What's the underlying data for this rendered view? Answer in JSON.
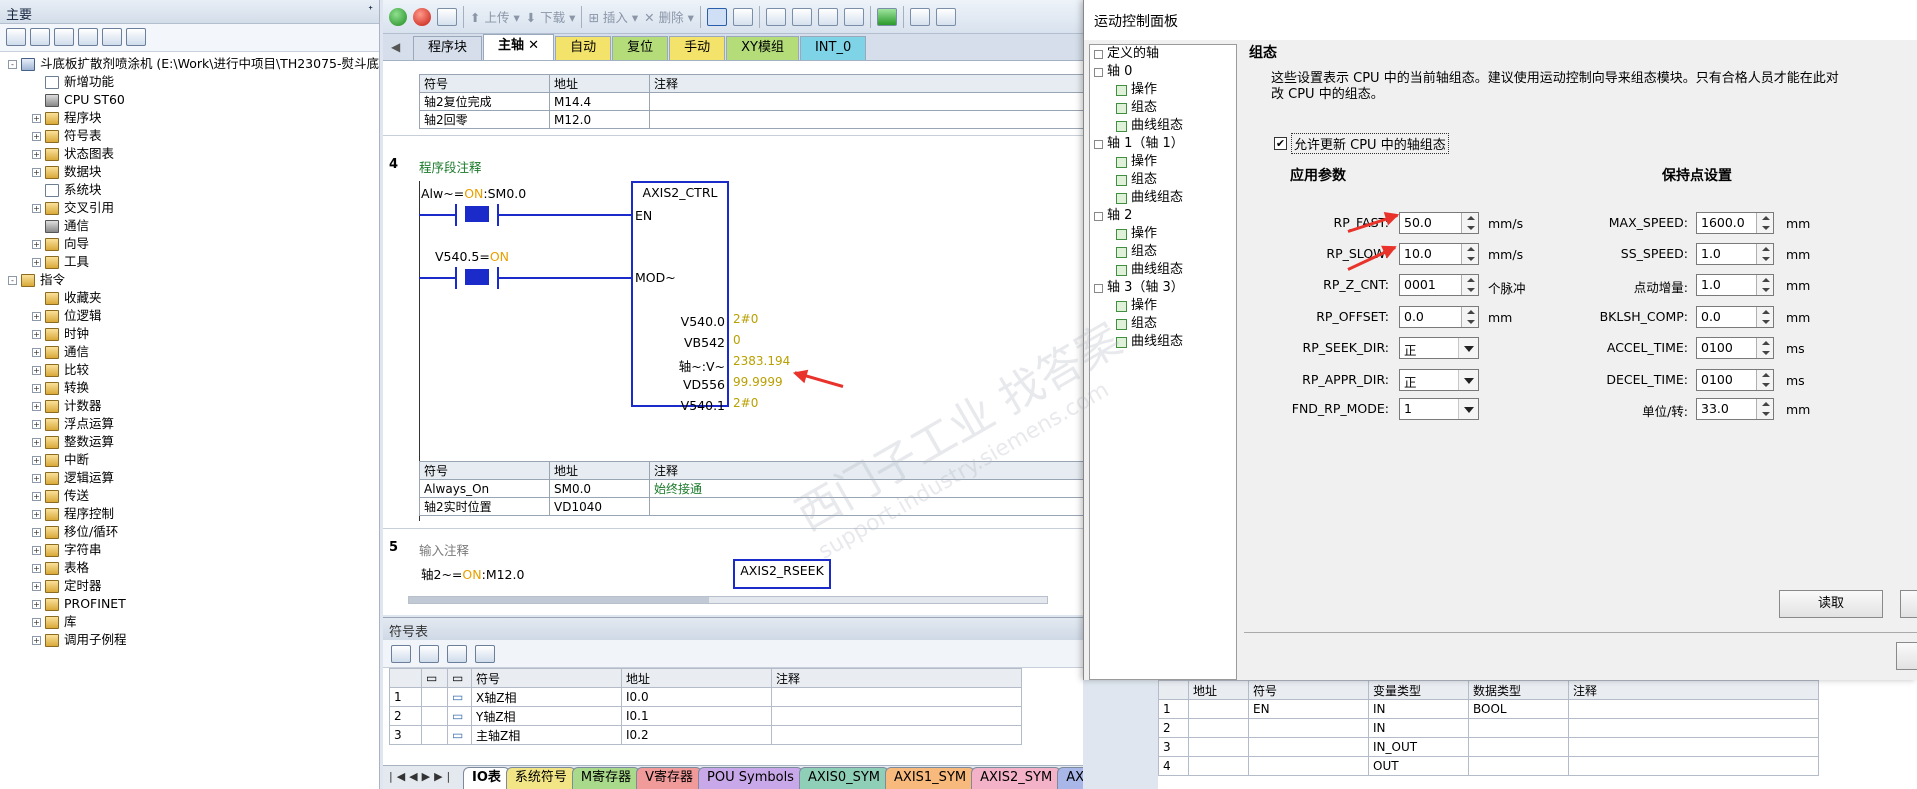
{
  "left_panel": {
    "title": "主要",
    "pin": "ᐩ",
    "tree": [
      {
        "label": "斗底板扩散剂喷涂机 (E:\\Work\\进行中项目\\TH23075-熨斗底",
        "level": 0,
        "exp": "-"
      },
      {
        "label": "新增功能",
        "level": 1,
        "exp": ""
      },
      {
        "label": "CPU ST60",
        "level": 1,
        "exp": ""
      },
      {
        "label": "程序块",
        "level": 1,
        "exp": "+"
      },
      {
        "label": "符号表",
        "level": 1,
        "exp": "+"
      },
      {
        "label": "状态图表",
        "level": 1,
        "exp": "+"
      },
      {
        "label": "数据块",
        "level": 1,
        "exp": "+"
      },
      {
        "label": "系统块",
        "level": 1,
        "exp": ""
      },
      {
        "label": "交叉引用",
        "level": 1,
        "exp": "+"
      },
      {
        "label": "通信",
        "level": 1,
        "exp": ""
      },
      {
        "label": "向导",
        "level": 1,
        "exp": "+"
      },
      {
        "label": "工具",
        "level": 1,
        "exp": "+"
      },
      {
        "label": "指令",
        "level": 0,
        "exp": "-"
      },
      {
        "label": "收藏夹",
        "level": 1,
        "exp": ""
      },
      {
        "label": "位逻辑",
        "level": 1,
        "exp": "+"
      },
      {
        "label": "时钟",
        "level": 1,
        "exp": "+"
      },
      {
        "label": "通信",
        "level": 1,
        "exp": "+"
      },
      {
        "label": "比较",
        "level": 1,
        "exp": "+"
      },
      {
        "label": "转换",
        "level": 1,
        "exp": "+"
      },
      {
        "label": "计数器",
        "level": 1,
        "exp": "+"
      },
      {
        "label": "浮点运算",
        "level": 1,
        "exp": "+"
      },
      {
        "label": "整数运算",
        "level": 1,
        "exp": "+"
      },
      {
        "label": "中断",
        "level": 1,
        "exp": "+"
      },
      {
        "label": "逻辑运算",
        "level": 1,
        "exp": "+"
      },
      {
        "label": "传送",
        "level": 1,
        "exp": "+"
      },
      {
        "label": "程序控制",
        "level": 1,
        "exp": "+"
      },
      {
        "label": "移位/循环",
        "level": 1,
        "exp": "+"
      },
      {
        "label": "字符串",
        "level": 1,
        "exp": "+"
      },
      {
        "label": "表格",
        "level": 1,
        "exp": "+"
      },
      {
        "label": "定时器",
        "level": 1,
        "exp": "+"
      },
      {
        "label": "PROFINET",
        "level": 1,
        "exp": "+"
      },
      {
        "label": "库",
        "level": 1,
        "exp": "+"
      },
      {
        "label": "调用子例程",
        "level": 1,
        "exp": "+"
      }
    ]
  },
  "toolbar": {
    "upload": "上传",
    "download": "下载",
    "insert": "插入",
    "delete": "删除"
  },
  "editor_tabs": [
    {
      "label": "程序块",
      "color": "#d5deea"
    },
    {
      "label": "主轴",
      "color": "#ffffff",
      "active": true
    },
    {
      "label": "自动",
      "color": "#f3e36a"
    },
    {
      "label": "复位",
      "color": "#b4dd7a"
    },
    {
      "label": "手动",
      "color": "#f3e36a"
    },
    {
      "label": "XY模组",
      "color": "#b4dd7a"
    },
    {
      "label": "INT_0",
      "color": "#7fd3e6"
    }
  ],
  "code": {
    "sym_header": [
      "符号",
      "地址",
      "注释"
    ],
    "sym_top": [
      [
        "轴2复位完成",
        "M14.4",
        ""
      ],
      [
        "轴2回零",
        "M12.0",
        ""
      ]
    ],
    "net4": {
      "number": "4",
      "comment": "程序段注释",
      "contact1_name": "Alw~=",
      "contact1_state": "ON",
      "contact1_addr": ":SM0.0",
      "contact2_name": "V540.5=",
      "contact2_state": "ON",
      "box_title": "AXIS2_CTRL",
      "pin_en": "EN",
      "pin_mod": "MOD~",
      "outputs": [
        {
          "name": "V540.0",
          "value": "2#0"
        },
        {
          "name": "VB542",
          "value": "0"
        },
        {
          "name": "轴~:V~",
          "value": "2383.194"
        },
        {
          "name": "VD556",
          "value": "99.9999"
        },
        {
          "name": "V540.1",
          "value": "2#0"
        }
      ],
      "sym_rows": [
        [
          "Always_On",
          "SM0.0",
          "始终接通"
        ],
        [
          "轴2实时位置",
          "VD1040",
          ""
        ]
      ]
    },
    "net5": {
      "number": "5",
      "comment": "输入注释",
      "contact_name": "轴2~=",
      "contact_state": "ON",
      "contact_addr": ":M12.0",
      "box_title": "AXIS2_RSEEK"
    }
  },
  "symtable": {
    "title": "符号表",
    "headers": [
      "",
      "",
      "符号",
      "地址",
      "注释"
    ],
    "rows": [
      [
        "1",
        "X轴Z相",
        "I0.0",
        ""
      ],
      [
        "2",
        "Y轴Z相",
        "I0.1",
        ""
      ],
      [
        "3",
        "主轴Z相",
        "I0.2",
        ""
      ]
    ],
    "tabs": [
      {
        "label": "IO表",
        "color": "#ffffff"
      },
      {
        "label": "系统符号",
        "color": "#f1e585"
      },
      {
        "label": "M寄存器",
        "color": "#a9d98a"
      },
      {
        "label": "V寄存器",
        "color": "#f09a9a"
      },
      {
        "label": "POU Symbols",
        "color": "#c8a8e8"
      },
      {
        "label": "AXIS0_SYM",
        "color": "#8fcfb8"
      },
      {
        "label": "AXIS1_SYM",
        "color": "#f7b97c"
      },
      {
        "label": "AXIS2_SYM",
        "color": "#f3b2c8"
      },
      {
        "label": "AXIS3_S",
        "color": "#a8b6e8"
      }
    ]
  },
  "rtable": {
    "headers": [
      "",
      "地址",
      "符号",
      "变量类型",
      "数据类型",
      "注释"
    ],
    "rows": [
      [
        "1",
        "",
        "EN",
        "IN",
        "BOOL",
        ""
      ],
      [
        "2",
        "",
        "",
        "IN",
        "",
        ""
      ],
      [
        "3",
        "",
        "",
        "IN_OUT",
        "",
        ""
      ],
      [
        "4",
        "",
        "",
        "OUT",
        "",
        ""
      ]
    ]
  },
  "dialog": {
    "title": "运动控制面板",
    "tree": [
      {
        "label": "定义的轴",
        "type": "root"
      },
      {
        "label": "轴 0",
        "type": "axis"
      },
      {
        "label": "操作",
        "type": "leaf"
      },
      {
        "label": "组态",
        "type": "leaf"
      },
      {
        "label": "曲线组态",
        "type": "leaf"
      },
      {
        "label": "轴 1（轴 1）",
        "type": "axis"
      },
      {
        "label": "操作",
        "type": "leaf"
      },
      {
        "label": "组态",
        "type": "leaf"
      },
      {
        "label": "曲线组态",
        "type": "leaf"
      },
      {
        "label": "轴 2",
        "type": "axis"
      },
      {
        "label": "操作",
        "type": "leaf"
      },
      {
        "label": "组态",
        "type": "leaf"
      },
      {
        "label": "曲线组态",
        "type": "leaf"
      },
      {
        "label": "轴 3（轴 3）",
        "type": "axis"
      },
      {
        "label": "操作",
        "type": "leaf"
      },
      {
        "label": "组态",
        "type": "leaf"
      },
      {
        "label": "曲线组态",
        "type": "leaf"
      }
    ],
    "section_title": "组态",
    "description_line1": "这些设置表示 CPU 中的当前轴组态。建议使用运动控制向导来组态模块。只有合格人员才能在此对",
    "description_line2": "改 CPU 中的组态。",
    "allow_update_label": "允许更新 CPU 中的轴组态",
    "allow_update_checked": "✔",
    "app_params_title": "应用参数",
    "retain_title": "保持点设置",
    "app_params": [
      {
        "label": "RP_FAST:",
        "value": "50.0",
        "unit": "mm/s",
        "kind": "spin"
      },
      {
        "label": "RP_SLOW:",
        "value": "10.0",
        "unit": "mm/s",
        "kind": "spin"
      },
      {
        "label": "RP_Z_CNT:",
        "value": "0001",
        "unit": "个脉冲",
        "kind": "spin"
      },
      {
        "label": "RP_OFFSET:",
        "value": "0.0",
        "unit": "mm",
        "kind": "spin"
      },
      {
        "label": "RP_SEEK_DIR:",
        "value": "正",
        "unit": "",
        "kind": "select"
      },
      {
        "label": "RP_APPR_DIR:",
        "value": "正",
        "unit": "",
        "kind": "select"
      },
      {
        "label": "FND_RP_MODE:",
        "value": "1",
        "unit": "",
        "kind": "select"
      }
    ],
    "retain_params": [
      {
        "label": "MAX_SPEED:",
        "value": "1600.0",
        "unit": "mm"
      },
      {
        "label": "SS_SPEED:",
        "value": "1.0",
        "unit": "mm"
      },
      {
        "label": "点动增量:",
        "value": "1.0",
        "unit": "mm"
      },
      {
        "label": "BKLSH_COMP:",
        "value": "0.0",
        "unit": "mm"
      },
      {
        "label": "ACCEL_TIME:",
        "value": "0100",
        "unit": "ms"
      },
      {
        "label": "DECEL_TIME:",
        "value": "0100",
        "unit": "ms"
      },
      {
        "label": "单位/转:",
        "value": "33.0",
        "unit": "mm"
      }
    ],
    "read_button": "读取"
  },
  "watermark": {
    "line1": "西门子工业  找答案",
    "line2": "support.industry.siemens.com"
  },
  "colors": {
    "ladder": "#1b2bc9",
    "annotation_arrow": "#e8322a",
    "on_state": "#e8a000"
  }
}
